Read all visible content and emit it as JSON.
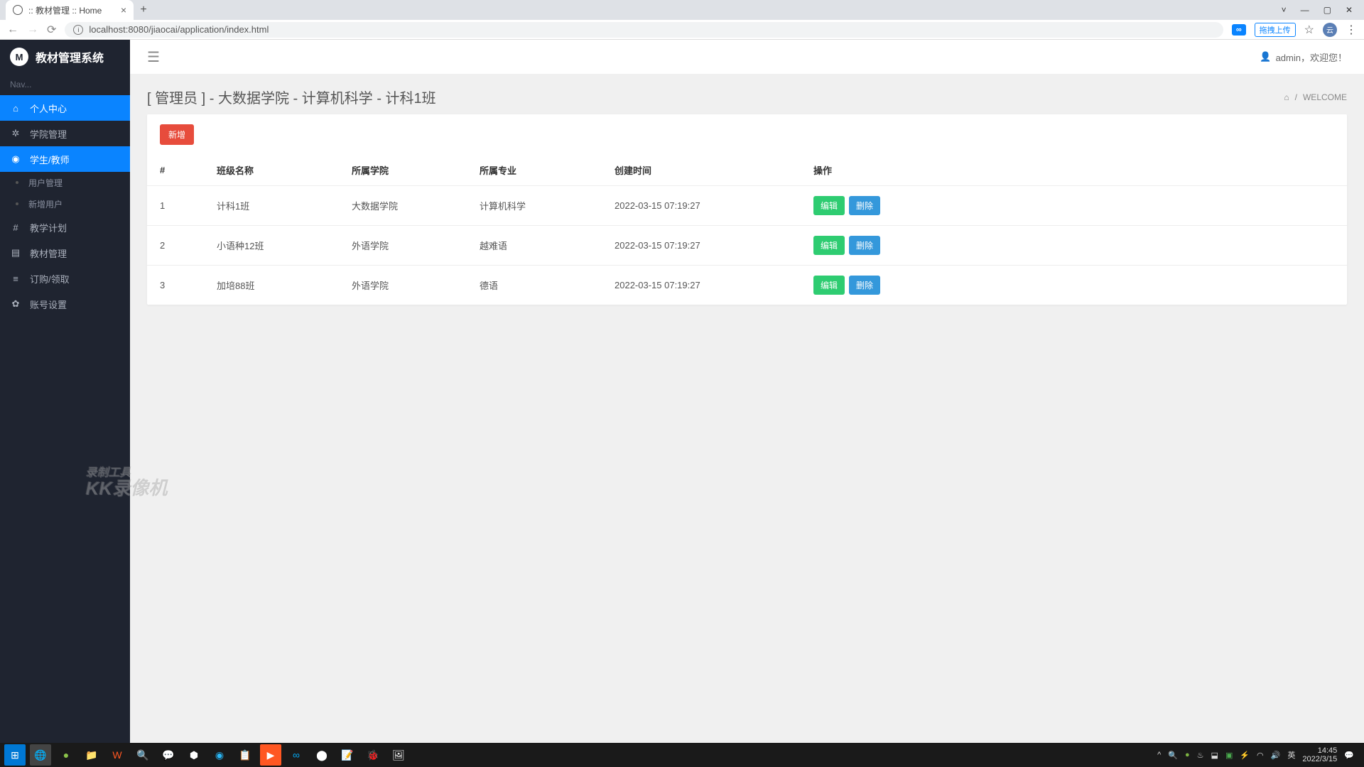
{
  "browser": {
    "tab_title": ":: 教材管理 :: Home",
    "url": "localhost:8080/jiaocai/application/index.html",
    "cloud_label": "拖拽上传"
  },
  "sidebar": {
    "app_name": "教材管理系统",
    "logo_text": "M",
    "nav_label": "Nav...",
    "items": {
      "home": "个人中心",
      "college": "学院管理",
      "students": "学生/教师",
      "user_mgmt": "用户管理",
      "add_user": "新增用户",
      "plan": "教学计划",
      "material": "教材管理",
      "order": "订购/领取",
      "account": "账号设置"
    }
  },
  "topbar": {
    "user_greeting": "admin，欢迎您！"
  },
  "page": {
    "title": "[ 管理员 ] - 大数据学院 - 计算机科学 - 计科1班",
    "breadcrumb": "WELCOME"
  },
  "card": {
    "add_button": "新增"
  },
  "table": {
    "headers": {
      "idx": "#",
      "class_name": "班级名称",
      "college": "所属学院",
      "major": "所属专业",
      "created": "创建时间",
      "actions": "操作"
    },
    "edit_label": "编辑",
    "delete_label": "删除",
    "rows": [
      {
        "idx": "1",
        "class_name": "计科1班",
        "college": "大数据学院",
        "major": "计算机科学",
        "created": "2022-03-15 07:19:27"
      },
      {
        "idx": "2",
        "class_name": "小语种12班",
        "college": "外语学院",
        "major": "越难语",
        "created": "2022-03-15 07:19:27"
      },
      {
        "idx": "3",
        "class_name": "加培88班",
        "college": "外语学院",
        "major": "德语",
        "created": "2022-03-15 07:19:27"
      }
    ]
  },
  "watermark": {
    "line1": "录制工具",
    "line2": "KK录像机"
  },
  "taskbar": {
    "ime": "英",
    "time": "14:45",
    "date": "2022/3/15"
  }
}
